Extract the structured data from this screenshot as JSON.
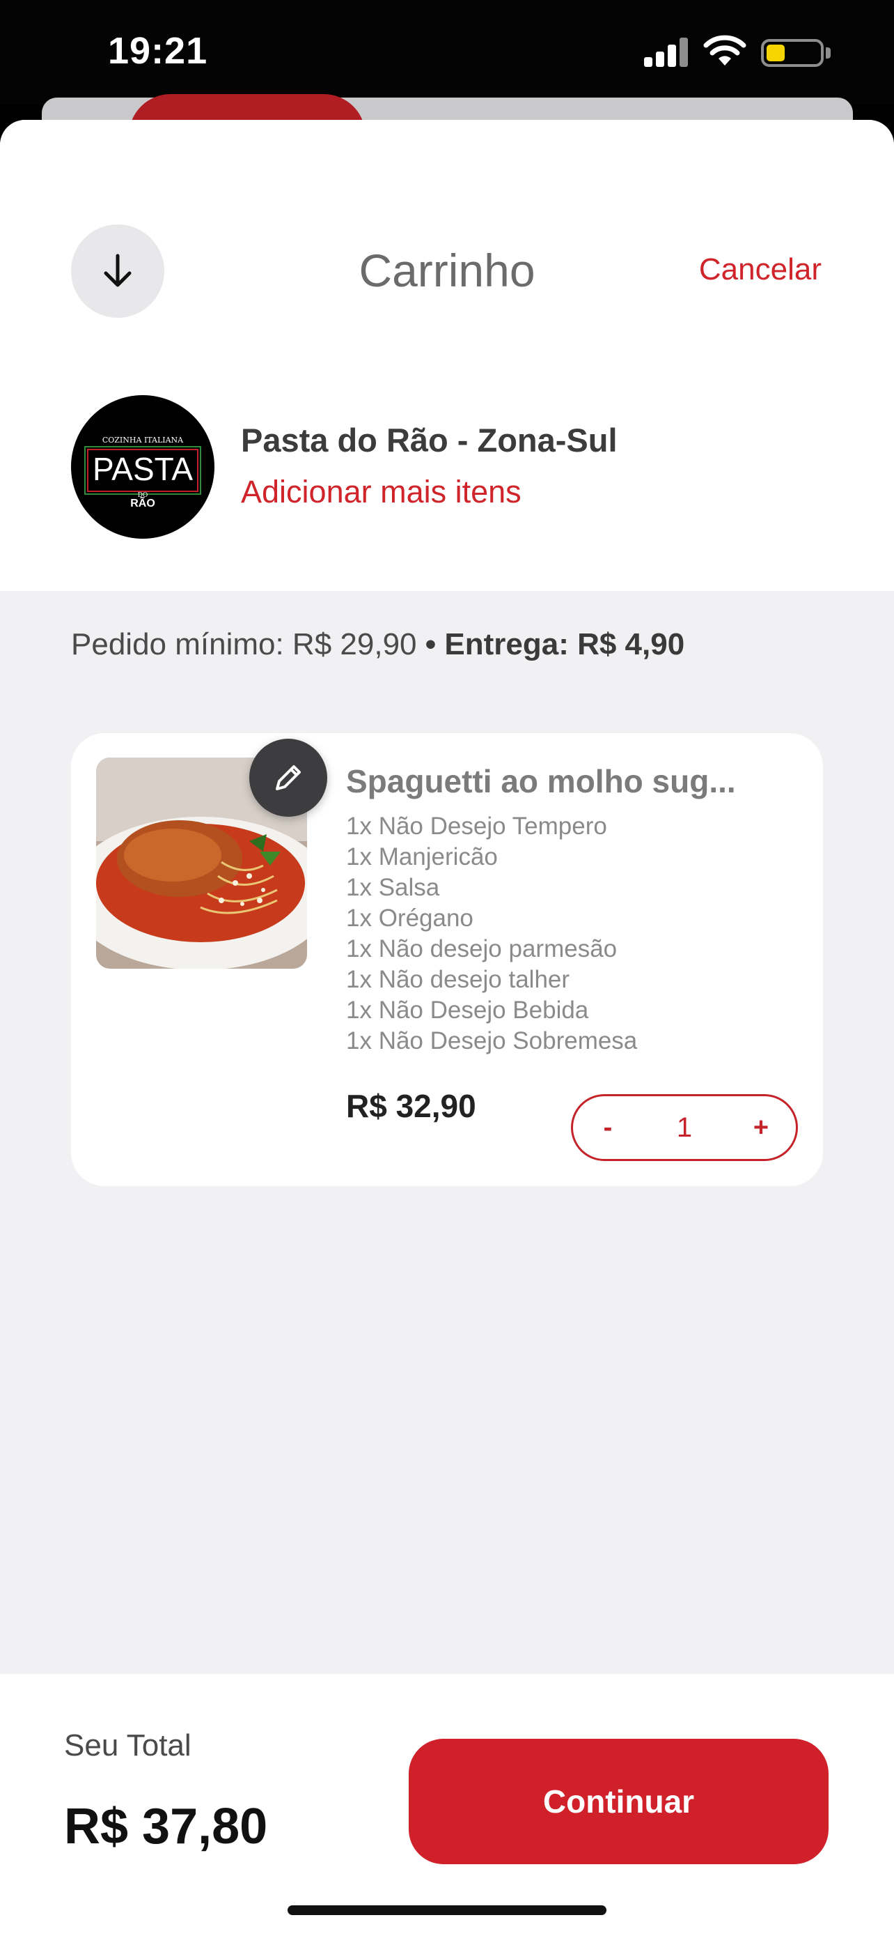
{
  "status_bar": {
    "time": "19:21"
  },
  "header": {
    "title": "Carrinho",
    "cancel_label": "Cancelar"
  },
  "store": {
    "name": "Pasta do Rão - Zona-Sul",
    "add_more_label": "Adicionar mais itens",
    "logo": {
      "top_text": "COZINHA ITALIANA",
      "main_text": "PASTA",
      "small_text": "DO",
      "bottom_text": "RÃO"
    }
  },
  "order_info": {
    "min_order": "Pedido mínimo: R$ 29,90",
    "separator": "•",
    "delivery": "Entrega: R$ 4,90"
  },
  "cart_items": [
    {
      "name": "Spaguetti ao molho sug...",
      "options": [
        "1x Não Desejo Tempero",
        "1x Manjericão",
        "1x Salsa",
        "1x Orégano",
        "1x Não desejo parmesão",
        "1x Não desejo talher",
        "1x Não Desejo Bebida",
        "1x Não Desejo Sobremesa"
      ],
      "price": "R$ 32,90",
      "quantity": "1",
      "minus_label": "-",
      "plus_label": "+"
    }
  ],
  "footer": {
    "total_label": "Seu Total",
    "total_value": "R$ 37,80",
    "continue_label": "Continuar"
  },
  "colors": {
    "accent": "#d0202a",
    "background": "#f1f1f3"
  }
}
